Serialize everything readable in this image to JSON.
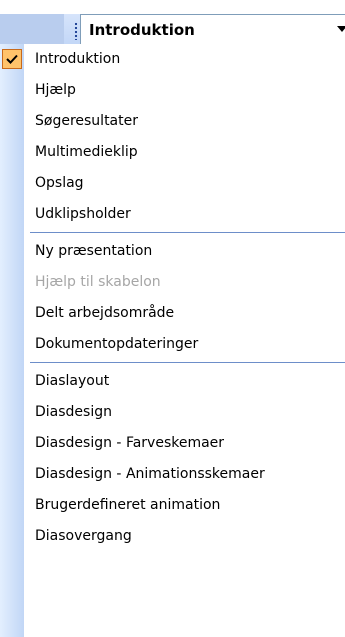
{
  "header": {
    "dropdown_value": "Introduktion"
  },
  "menu": {
    "groups": [
      [
        {
          "label": "Introduktion",
          "checked": true,
          "enabled": true
        },
        {
          "label": "Hjælp",
          "checked": false,
          "enabled": true
        },
        {
          "label": "Søgeresultater",
          "checked": false,
          "enabled": true
        },
        {
          "label": "Multimedieklip",
          "checked": false,
          "enabled": true
        },
        {
          "label": "Opslag",
          "checked": false,
          "enabled": true
        },
        {
          "label": "Udklipsholder",
          "checked": false,
          "enabled": true
        }
      ],
      [
        {
          "label": "Ny præsentation",
          "checked": false,
          "enabled": true
        },
        {
          "label": "Hjælp til skabelon",
          "checked": false,
          "enabled": false
        },
        {
          "label": "Delt arbejdsområde",
          "checked": false,
          "enabled": true
        },
        {
          "label": "Dokumentopdateringer",
          "checked": false,
          "enabled": true
        }
      ],
      [
        {
          "label": "Diaslayout",
          "checked": false,
          "enabled": true
        },
        {
          "label": "Diasdesign",
          "checked": false,
          "enabled": true
        },
        {
          "label": "Diasdesign - Farveskemaer",
          "checked": false,
          "enabled": true
        },
        {
          "label": "Diasdesign - Animationsskemaer",
          "checked": false,
          "enabled": true
        },
        {
          "label": "Brugerdefineret animation",
          "checked": false,
          "enabled": true
        },
        {
          "label": "Diasovergang",
          "checked": false,
          "enabled": true
        }
      ]
    ]
  },
  "colors": {
    "gutter_light": "#e3effe",
    "gutter_dark": "#c1d6f6",
    "checked_bg": "#ffc36b",
    "separator": "#6d8ec9",
    "disabled_text": "#a6a6a6"
  },
  "icons": {
    "checked": "checkmark-icon",
    "dropdown": "chevron-down-icon",
    "grip": "grip-dots-icon"
  }
}
